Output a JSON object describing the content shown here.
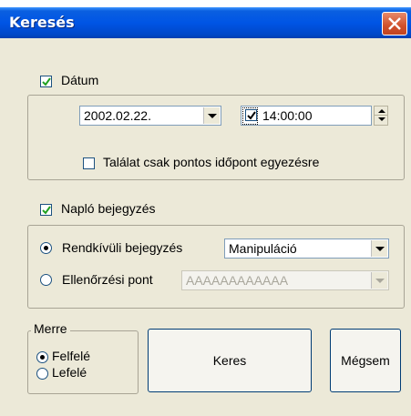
{
  "window": {
    "title": "Keresés"
  },
  "date_section": {
    "checkbox_label": "Dátum",
    "checked": true,
    "date_value": "2002.02.22.",
    "time_checked": true,
    "time_value": "14:00:00",
    "exact_match_label": "Találat csak pontos időpont egyezésre",
    "exact_match_checked": false
  },
  "log_section": {
    "checkbox_label": "Napló bejegyzés",
    "checked": true,
    "radio_special_label": "Rendkívüli bejegyzés",
    "special_value": "Manipuláció",
    "radio_checkpoint_label": "Ellenőrzési pont",
    "checkpoint_value": "AAAAAAAAAAAA"
  },
  "direction": {
    "group_label": "Merre",
    "up_label": "Felfelé",
    "down_label": "Lefelé",
    "selected": "Felfelé"
  },
  "buttons": {
    "search_label": "Keres",
    "cancel_label": "Mégsem"
  }
}
